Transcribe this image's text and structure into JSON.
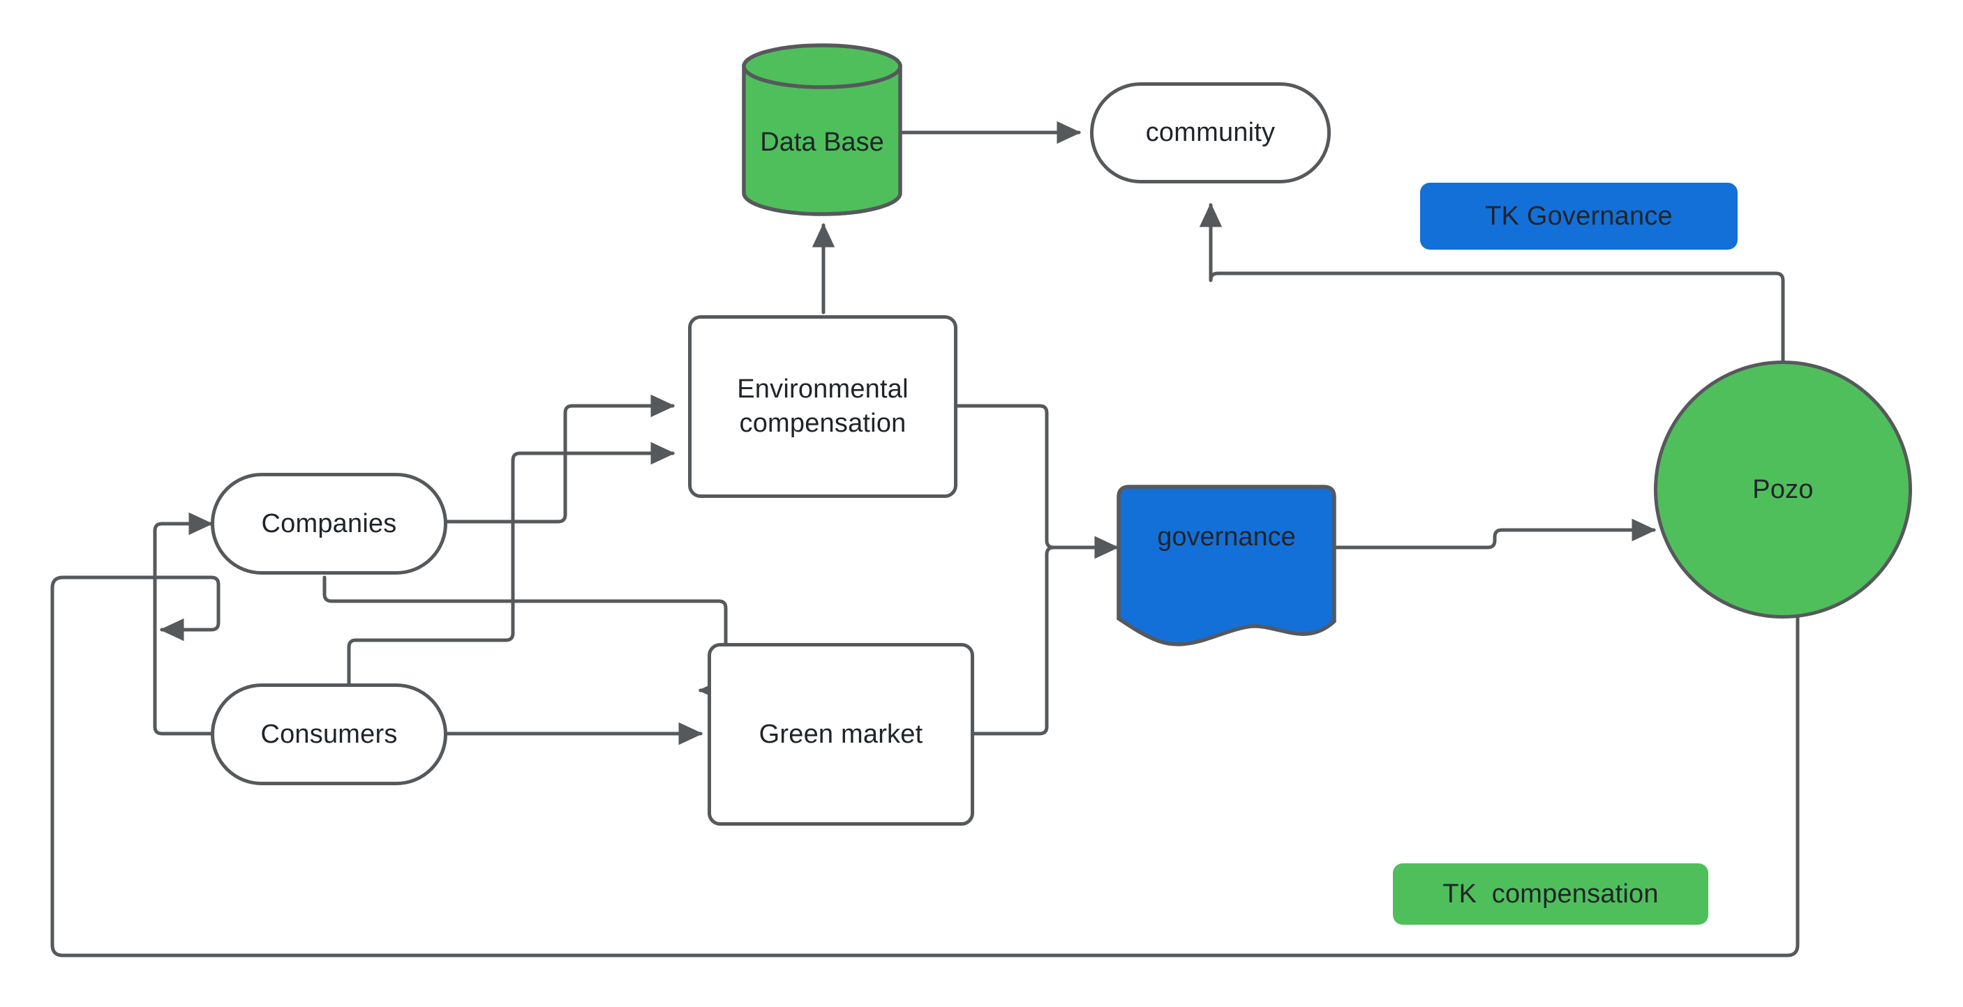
{
  "diagram": {
    "title": "Environmental compensation governance flow",
    "background": "#ffffff",
    "colors": {
      "stroke": "#56595b",
      "green": "#4fbf5c",
      "blue": "#1370d8",
      "text": "#1f2429",
      "white": "#ffffff"
    },
    "nodes": [
      {
        "id": "database",
        "label": "Data Base",
        "shape": "cylinder",
        "fill": "#4fbf5c",
        "border": "#56595b"
      },
      {
        "id": "community",
        "label": "community",
        "shape": "stadium",
        "fill": "#ffffff",
        "border": "#56595b"
      },
      {
        "id": "tk_governance",
        "label": "TK Governance",
        "shape": "rectangle",
        "fill": "#1370d8",
        "border": "none"
      },
      {
        "id": "envcomp",
        "label": "Environmental\ncompensation",
        "shape": "rectangle",
        "fill": "#ffffff",
        "border": "#56595b"
      },
      {
        "id": "companies",
        "label": "Companies",
        "shape": "stadium",
        "fill": "#ffffff",
        "border": "#56595b"
      },
      {
        "id": "consumers",
        "label": "Consumers",
        "shape": "stadium",
        "fill": "#ffffff",
        "border": "#56595b"
      },
      {
        "id": "greenmarket",
        "label": "Green market",
        "shape": "rectangle",
        "fill": "#ffffff",
        "border": "#56595b"
      },
      {
        "id": "governance",
        "label": "governance",
        "shape": "document",
        "fill": "#1370d8",
        "border": "#56595b"
      },
      {
        "id": "pozo",
        "label": "Pozo",
        "shape": "circle",
        "fill": "#4fbf5c",
        "border": "#56595b"
      },
      {
        "id": "tk_compensation",
        "label": "TK  compensation",
        "shape": "rectangle",
        "fill": "#4fbf5c",
        "border": "none"
      }
    ],
    "edges": [
      {
        "from": "database",
        "to": "community",
        "arrow": true
      },
      {
        "from": "envcomp",
        "to": "database",
        "arrow": true
      },
      {
        "from": "companies",
        "to": "envcomp",
        "arrow": true
      },
      {
        "from": "consumers",
        "to": "envcomp",
        "arrow": true
      },
      {
        "from": "companies",
        "to": "greenmarket",
        "arrow": true
      },
      {
        "from": "consumers",
        "to": "greenmarket",
        "arrow": true
      },
      {
        "from": "consumers",
        "to": "companies",
        "arrow": true
      },
      {
        "from": "envcomp",
        "to": "governance",
        "arrow": true
      },
      {
        "from": "greenmarket",
        "to": "governance",
        "arrow": true
      },
      {
        "from": "governance",
        "to": "pozo",
        "arrow": true
      },
      {
        "from": "pozo",
        "to": "community",
        "arrow": true
      },
      {
        "from": "pozo",
        "to": "companies",
        "arrow": true
      }
    ]
  }
}
